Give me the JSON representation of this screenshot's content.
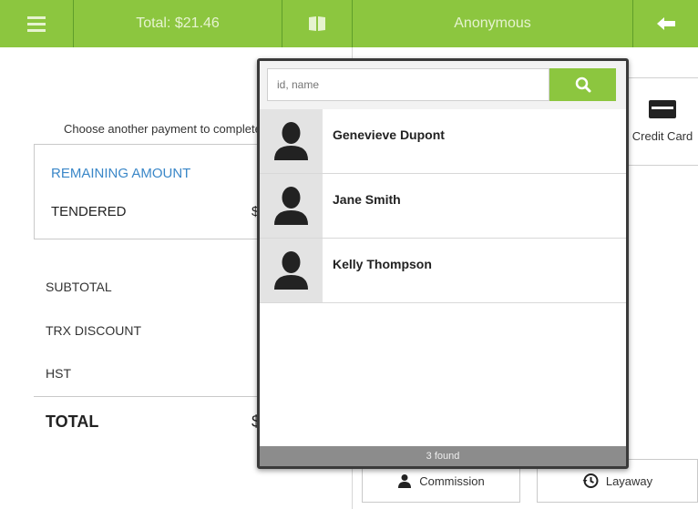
{
  "topbar": {
    "total_label": "Total: $21.46",
    "customer_label": "Anonymous"
  },
  "left": {
    "choose_text": "Choose another payment to complete t",
    "remaining_label": "REMAINING AMOUNT",
    "tendered_label": "TENDERED",
    "tendered_value_fragment": "$",
    "subtotal_label": "SUBTOTAL",
    "trx_discount_label": "TRX DISCOUNT",
    "hst_label": "HST",
    "total_label": "TOTAL",
    "total_value_fragment": "$"
  },
  "right": {
    "credit_card_label": "Credit Card",
    "commission_label": "Commission",
    "layaway_label": "Layaway"
  },
  "popup": {
    "search_placeholder": "id, name",
    "customers": [
      {
        "name": "Genevieve Dupont"
      },
      {
        "name": "Jane Smith"
      },
      {
        "name": "Kelly Thompson"
      }
    ],
    "found_text": "3 found"
  },
  "colors": {
    "accent": "#8cc63f",
    "link_blue": "#3a87c8",
    "footer_gray": "#8c8c8c"
  },
  "icons": [
    "menu-icon",
    "card-icon",
    "back-arrow-icon",
    "search-icon",
    "person-icon",
    "credit-card-icon",
    "history-icon"
  ]
}
